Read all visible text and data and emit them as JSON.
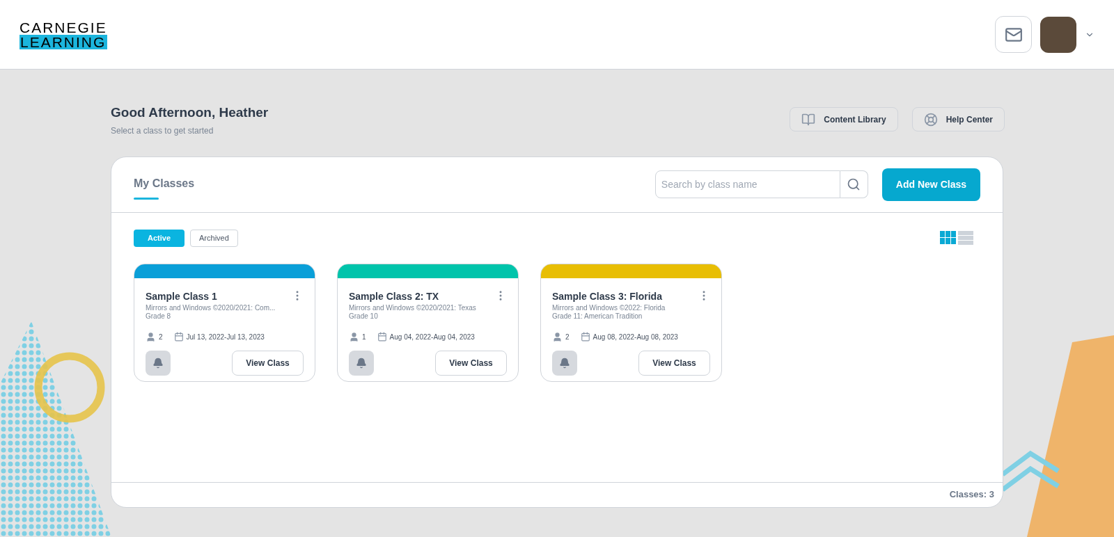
{
  "logo": {
    "line_1": "CARNEGIE",
    "line_2": "LEARNING"
  },
  "greeting": {
    "title": "Good Afternoon, Heather",
    "subtitle": "Select a class to get started"
  },
  "quick_links": [
    {
      "kind": "library",
      "label": "Content Library"
    },
    {
      "kind": "help",
      "label": "Help Center"
    }
  ],
  "panel": {
    "tab": "My Classes",
    "search": {
      "placeholder": "Search by class name"
    },
    "add_button": "Add New Class",
    "filters": [
      {
        "label": "Active",
        "selected": true
      },
      {
        "label": "Archived",
        "selected": false
      }
    ],
    "views": [
      {
        "kind": "grid",
        "selected": true
      },
      {
        "kind": "list",
        "selected": false
      }
    ],
    "classes": [
      {
        "name": "Sample Class 1",
        "curriculum": "Mirrors and Windows ©2020/2021: Com...",
        "grade": "Grade 8",
        "students": "2",
        "dates": "Jul 13, 2022-Jul 13, 2023",
        "color": "#0a9fd8",
        "button": "View Class"
      },
      {
        "name": "Sample Class 2: TX",
        "curriculum": "Mirrors and Windows ©2020/2021: Texas",
        "grade": "Grade 10",
        "students": "1",
        "dates": "Aug 04, 2022-Aug 04, 2023",
        "color": "#00c4ab",
        "button": "View Class"
      },
      {
        "name": "Sample Class 3: Florida",
        "curriculum": "Mirrors and Windows ©2022: Florida",
        "grade": "Grade 11: American Tradition",
        "students": "2",
        "dates": "Aug 08, 2022-Aug 08, 2023",
        "color": "#e8be04",
        "button": "View Class"
      }
    ],
    "footer": "Classes: 3"
  }
}
